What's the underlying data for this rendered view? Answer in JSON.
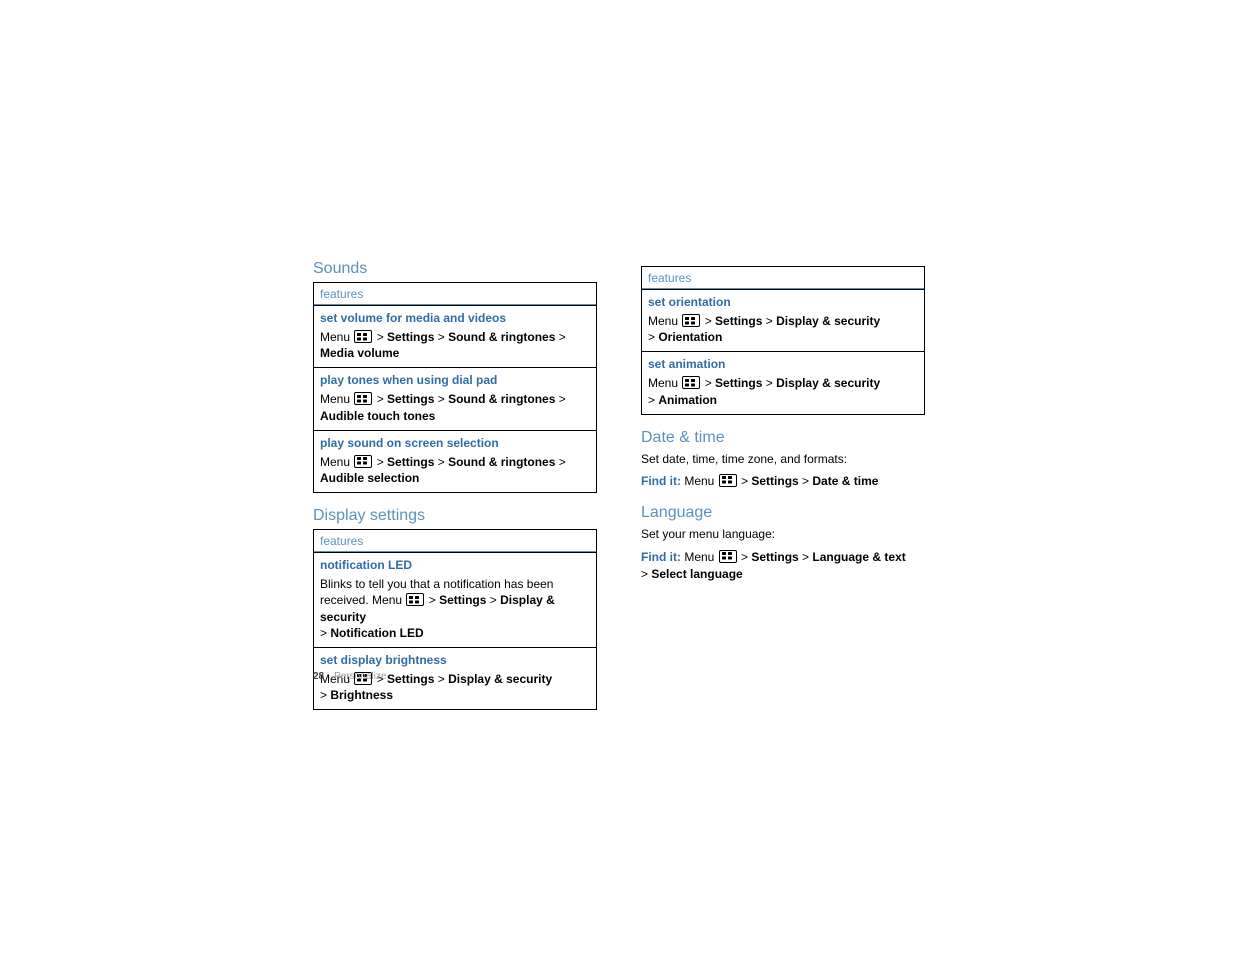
{
  "left": {
    "sounds_heading": "Sounds",
    "features_label": "features",
    "sounds": [
      {
        "title": "set volume for media and videos",
        "prefix": "Menu ",
        "sep": " > ",
        "p1": "Settings",
        "p2": "Sound & ringtones",
        "p3": "Media volume"
      },
      {
        "title": "play tones when using dial pad",
        "prefix": "Menu ",
        "sep": " > ",
        "p1": "Settings",
        "p2": "Sound & ringtones",
        "p3": "Audible touch tones"
      },
      {
        "title": "play sound on screen selection",
        "prefix": "Menu ",
        "sep": " > ",
        "p1": "Settings",
        "p2": "Sound & ringtones",
        "p3": "Audible selection"
      }
    ],
    "display_heading": "Display settings",
    "display": [
      {
        "title": "notification LED",
        "body_pre": "Blinks to tell you that a notification has been received. Menu ",
        "sep": " > ",
        "p1": "Settings",
        "p2": "Display & security",
        "sep2": " > ",
        "p3": "Notification LED"
      },
      {
        "title": "set display brightness",
        "prefix": "Menu ",
        "sep": " > ",
        "p1": "Settings",
        "p2": "Display & security",
        "sep2": " > ",
        "p3": "Brightness"
      }
    ]
  },
  "right": {
    "features_label": "features",
    "rows": [
      {
        "title": "set orientation",
        "prefix": "Menu ",
        "sep": " > ",
        "p1": "Settings",
        "p2": "Display & security",
        "sep2": " > ",
        "p3": "Orientation"
      },
      {
        "title": "set animation",
        "prefix": "Menu ",
        "sep": " > ",
        "p1": "Settings",
        "p2": "Display & security",
        "sep2": " > ",
        "p3": "Animation"
      }
    ],
    "date_heading": "Date & time",
    "date_desc": "Set date, time, time zone, and formats:",
    "findit_label": "Find it:",
    "date_prefix": " Menu ",
    "date_sep": " > ",
    "date_p1": "Settings",
    "date_p2": "Date & time",
    "lang_heading": "Language",
    "lang_desc": "Set your menu language:",
    "lang_prefix": " Menu ",
    "lang_sep": " > ",
    "lang_p1": "Settings",
    "lang_p2": "Language & text",
    "lang_sep2": " > ",
    "lang_p3": "Select language"
  },
  "footer": {
    "page": "28",
    "section": "Personalize"
  }
}
